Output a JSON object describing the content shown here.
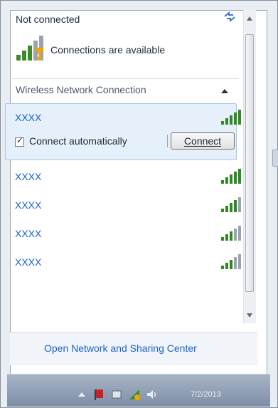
{
  "header": {
    "status": "Not connected",
    "availability": "Connections are available"
  },
  "section": {
    "title": "Wireless Network Connection"
  },
  "networks": [
    {
      "name": "XXXX"
    },
    {
      "name": "XXXX"
    },
    {
      "name": "XXXX"
    },
    {
      "name": "XXXX"
    },
    {
      "name": "XXXX"
    }
  ],
  "selected": {
    "auto_label": "Connect automatically",
    "connect_button": "Connect",
    "auto_checked": true
  },
  "footer": {
    "link": "Open Network and Sharing Center"
  },
  "taskbar": {
    "clock": "7/2/2013"
  },
  "icons": {
    "refresh": "refresh-icon",
    "connections": "network-warning-icon",
    "collapse": "chevron-up-icon",
    "signal": "wifi-signal-icon"
  }
}
